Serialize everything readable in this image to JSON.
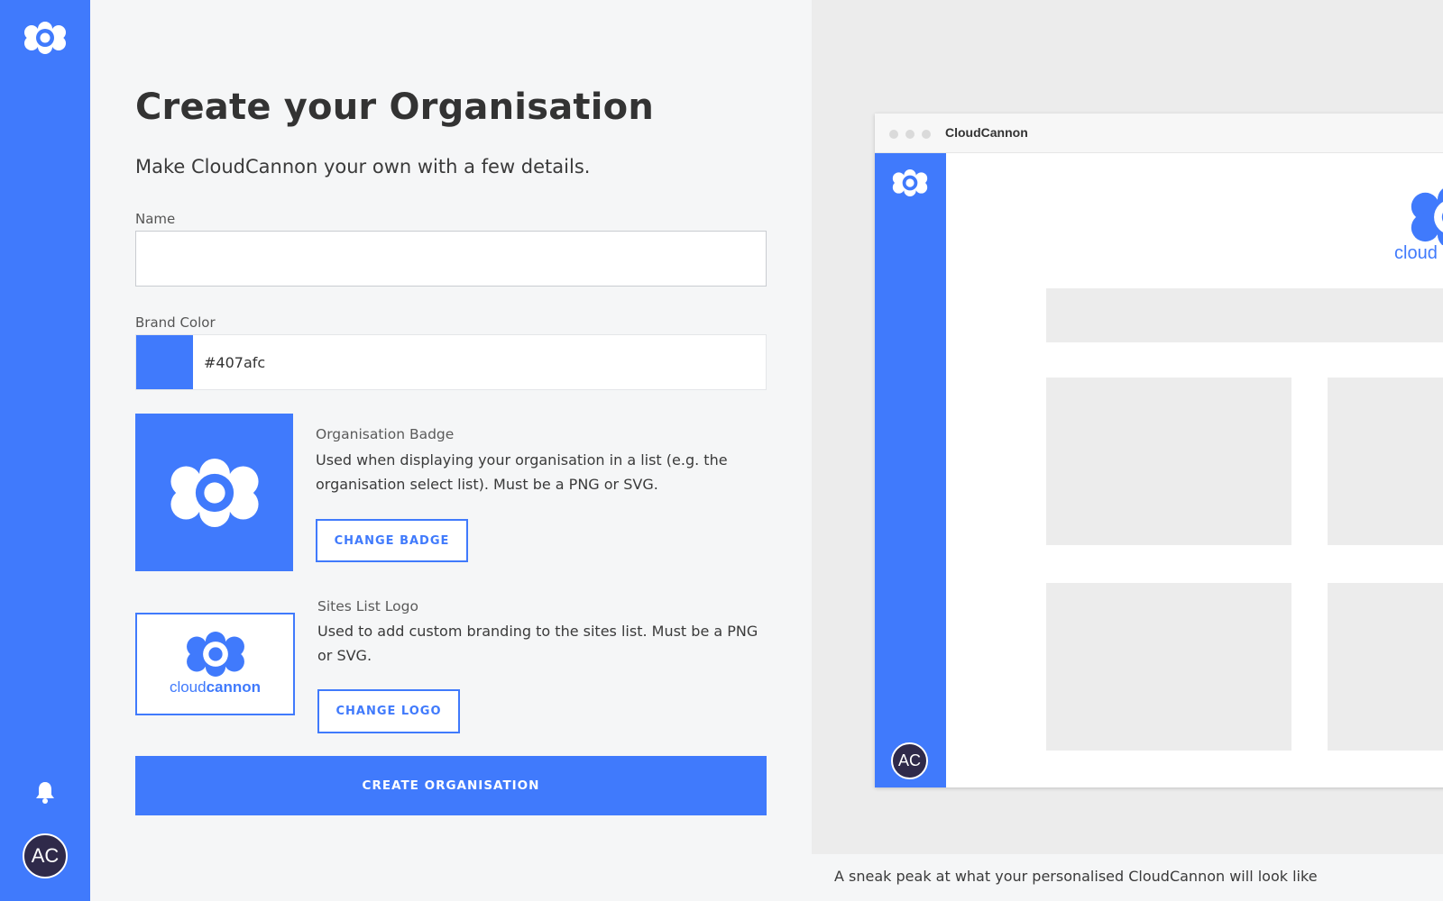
{
  "brand": {
    "accent": "#407afc",
    "avatar_bg": "#2f2a4a",
    "name": "CloudCannon"
  },
  "sidebar": {
    "logo_icon": "cloudcannon-logo-icon",
    "bell_icon": "bell-icon",
    "avatar_initials": "AC"
  },
  "form": {
    "title": "Create your Organisation",
    "subtitle": "Make CloudCannon your own with a few details.",
    "name": {
      "label": "Name",
      "value": "",
      "placeholder": ""
    },
    "brand_color": {
      "label": "Brand Color",
      "value": "#407afc",
      "swatch": "#407afc"
    },
    "badge": {
      "heading": "Organisation Badge",
      "description": "Used when displaying your organisation in a list (e.g. the organisation select list). Must be a PNG or SVG.",
      "button": "CHANGE BADGE"
    },
    "logo": {
      "heading": "Sites List Logo",
      "description": "Used to add custom branding to the sites list. Must be a PNG or SVG.",
      "button": "CHANGE LOGO",
      "wordmark_light": "cloud",
      "wordmark_bold": "cannon"
    },
    "submit": "CREATE ORGANISATION"
  },
  "preview": {
    "window_title": "CloudCannon",
    "avatar_initials": "AC",
    "logo_wordmark": "cloud",
    "caption": "A sneak peak at what your personalised CloudCannon will look like"
  }
}
